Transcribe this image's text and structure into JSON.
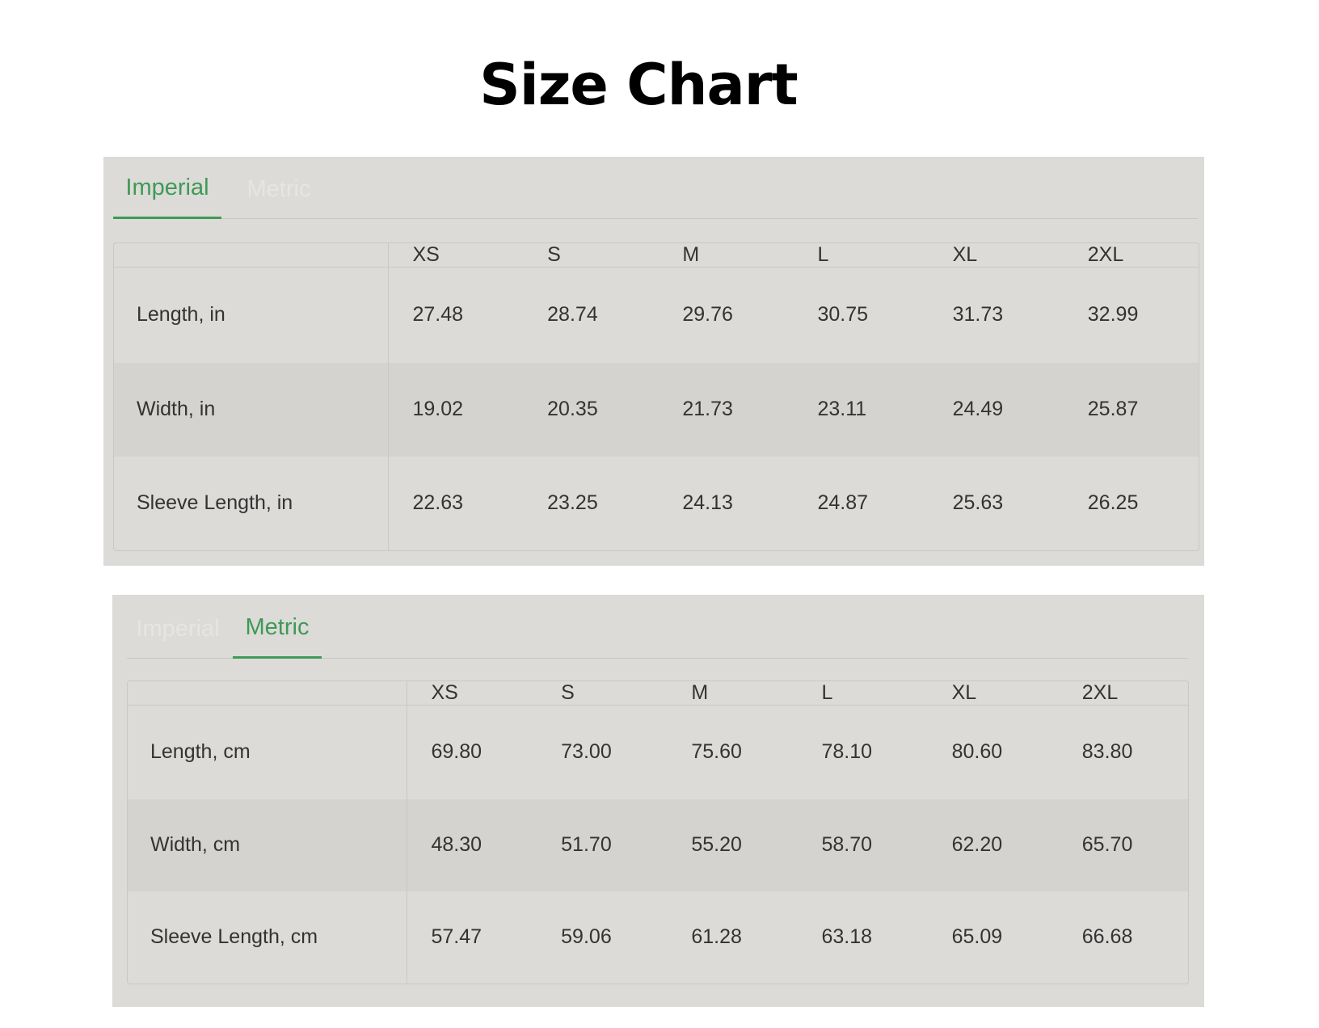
{
  "page_title": "Size Chart",
  "accent_color": "#3e9a55",
  "panel_background": "#dcdbd8",
  "imperial": {
    "tab_label": "Imperial",
    "headers": [
      "",
      "XS",
      "S",
      "M",
      "L",
      "XL",
      "2XL"
    ],
    "rows": [
      {
        "label": "Length, in",
        "values": [
          "27.48",
          "28.74",
          "29.76",
          "30.75",
          "31.73",
          "32.99"
        ]
      },
      {
        "label": "Width, in",
        "values": [
          "19.02",
          "20.35",
          "21.73",
          "23.11",
          "24.49",
          "25.87"
        ]
      },
      {
        "label": "Sleeve Length, in",
        "values": [
          "22.63",
          "23.25",
          "24.13",
          "24.87",
          "25.63",
          "26.25"
        ]
      }
    ]
  },
  "metric": {
    "tab_label": "Metric",
    "headers": [
      "",
      "XS",
      "S",
      "M",
      "L",
      "XL",
      "2XL"
    ],
    "rows": [
      {
        "label": "Length, cm",
        "values": [
          "69.80",
          "73.00",
          "75.60",
          "78.10",
          "80.60",
          "83.80"
        ]
      },
      {
        "label": "Width, cm",
        "values": [
          "48.30",
          "51.70",
          "55.20",
          "58.70",
          "62.20",
          "65.70"
        ]
      },
      {
        "label": "Sleeve Length, cm",
        "values": [
          "57.47",
          "59.06",
          "61.28",
          "63.18",
          "65.09",
          "66.68"
        ]
      }
    ]
  }
}
